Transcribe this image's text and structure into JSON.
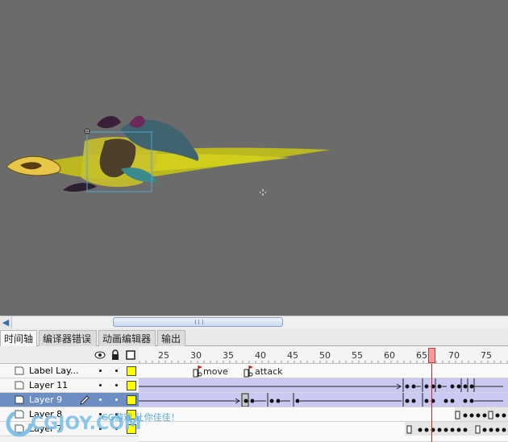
{
  "tabs": [
    {
      "label": "时间轴",
      "active": true
    },
    {
      "label": "编译器错误",
      "active": false
    },
    {
      "label": "动画编辑器",
      "active": false
    },
    {
      "label": "输出",
      "active": false
    }
  ],
  "ruler": {
    "ticks": [
      "25",
      "30",
      "35",
      "40",
      "45",
      "50",
      "55",
      "60",
      "65",
      "70",
      "75"
    ],
    "current_frame": 67
  },
  "layers": [
    {
      "name": "Label Lay...",
      "selected": false
    },
    {
      "name": "Layer 11",
      "selected": false
    },
    {
      "name": "Layer 9",
      "selected": true
    },
    {
      "name": "Layer 8",
      "selected": false
    },
    {
      "name": "Layer 7",
      "selected": false
    }
  ],
  "frame_labels": [
    {
      "text": "move",
      "frame": 30
    },
    {
      "text": "attack",
      "frame": 38
    }
  ],
  "icons": {
    "eye": "eye-icon",
    "lock": "lock-icon",
    "outline": "outline-icon",
    "pencil": "pencil-icon",
    "scroll_left": "chevron-left-icon"
  },
  "colors": {
    "stage": "#6b6b6b",
    "selected_layer": "#6c8ec4",
    "tween_fill": "#c9c9f4",
    "playhead": "#d42020",
    "layer_outline": "#ffff00"
  },
  "watermark": {
    "logo": "CGJOY.COM",
    "slogan": "CG游戏,让你佳佳！"
  }
}
